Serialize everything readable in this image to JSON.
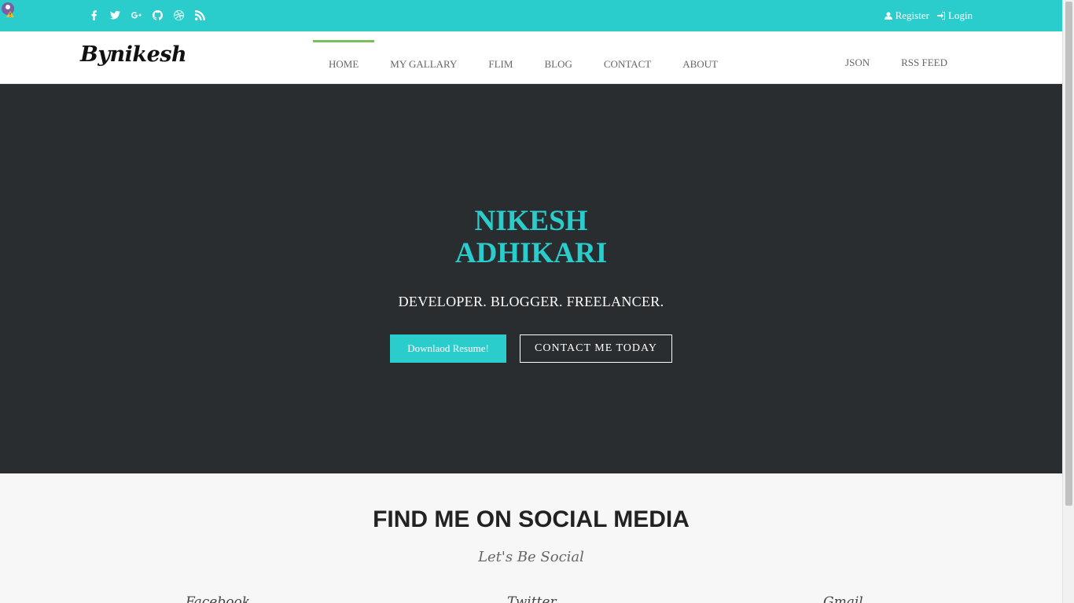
{
  "topbar": {
    "social_icons": [
      "facebook-icon",
      "twitter-icon",
      "google-plus-icon",
      "github-icon",
      "dribbble-icon",
      "rss-icon"
    ],
    "register_label": "Register",
    "login_label": "Login"
  },
  "navbar": {
    "logo": "Bynikesh",
    "items": [
      {
        "label": "HOME",
        "active": true
      },
      {
        "label": "MY GALLARY"
      },
      {
        "label": "FLIM"
      },
      {
        "label": "BLOG"
      },
      {
        "label": "CONTACT"
      },
      {
        "label": "ABOUT"
      }
    ],
    "right_items": [
      {
        "label": "JSON"
      },
      {
        "label": "RSS FEED"
      }
    ]
  },
  "hero": {
    "name_line1": "NIKESH",
    "name_line2": "ADHIKARI",
    "tagline": "DEVELOPER. BLOGGER. FREELANCER.",
    "resume_button": "Downlaod Resume!",
    "contact_button": "CONTACT ME TODAY"
  },
  "social_section": {
    "title": "FIND ME ON SOCIAL MEDIA",
    "subtitle": "Let's Be Social",
    "columns": [
      "Facebook",
      "Twitter",
      "Gmail"
    ]
  },
  "colors": {
    "accent": "#2bcdcc",
    "hero_bg": "#2a2d30",
    "active_nav": "#7bbf5b"
  }
}
